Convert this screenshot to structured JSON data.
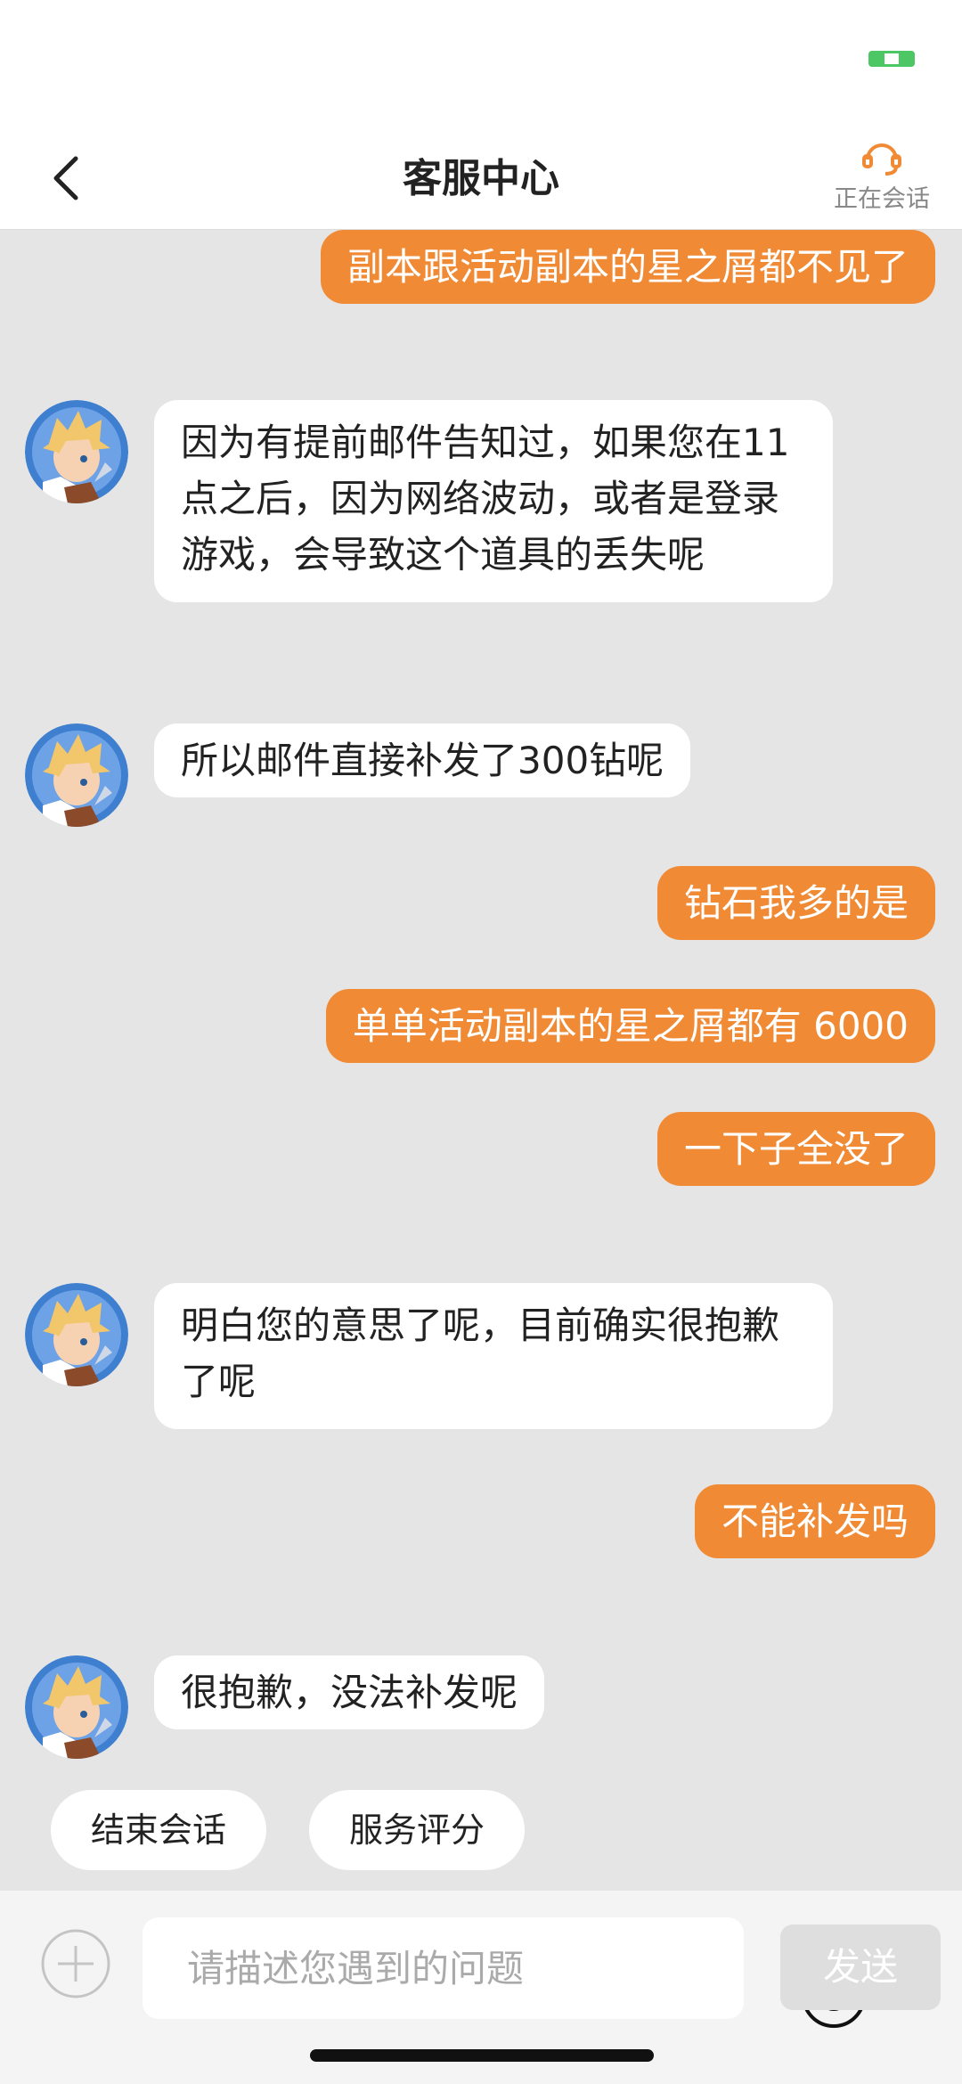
{
  "header": {
    "title": "客服中心",
    "agent_status": "正在会话"
  },
  "messages": [
    {
      "from": "user",
      "text": "副本跟活动副本的星之屑都不见了"
    },
    {
      "from": "agent",
      "text": "因为有提前邮件告知过，如果您在11点之后，因为网络波动，或者是登录游戏，会导致这个道具的丢失呢"
    },
    {
      "from": "agent",
      "text": "所以邮件直接补发了300钻呢"
    },
    {
      "from": "user",
      "text": "钻石我多的是"
    },
    {
      "from": "user",
      "text": "单单活动副本的星之屑都有 6000"
    },
    {
      "from": "user",
      "text": "一下子全没了"
    },
    {
      "from": "agent",
      "text": "明白您的意思了呢，目前确实很抱歉了呢"
    },
    {
      "from": "user",
      "text": "不能补发吗"
    },
    {
      "from": "agent",
      "text": "很抱歉，没法补发呢"
    }
  ],
  "quick_actions": {
    "end_session": "结束会话",
    "rate_service": "服务评分"
  },
  "input": {
    "placeholder": "请描述您遇到的问题",
    "value": "",
    "send_label": "发送"
  },
  "colors": {
    "user_bubble": "#f08a34",
    "agent_bubble": "#ffffff",
    "chat_background": "#e5e5e5",
    "battery_green": "#4cc763",
    "headset_orange": "#f08a34"
  },
  "icons": {
    "back": "chevron-left-icon",
    "agent": "headset-icon",
    "battery": "battery-icon",
    "plus": "plus-icon",
    "emoji": "smiley-icon"
  }
}
